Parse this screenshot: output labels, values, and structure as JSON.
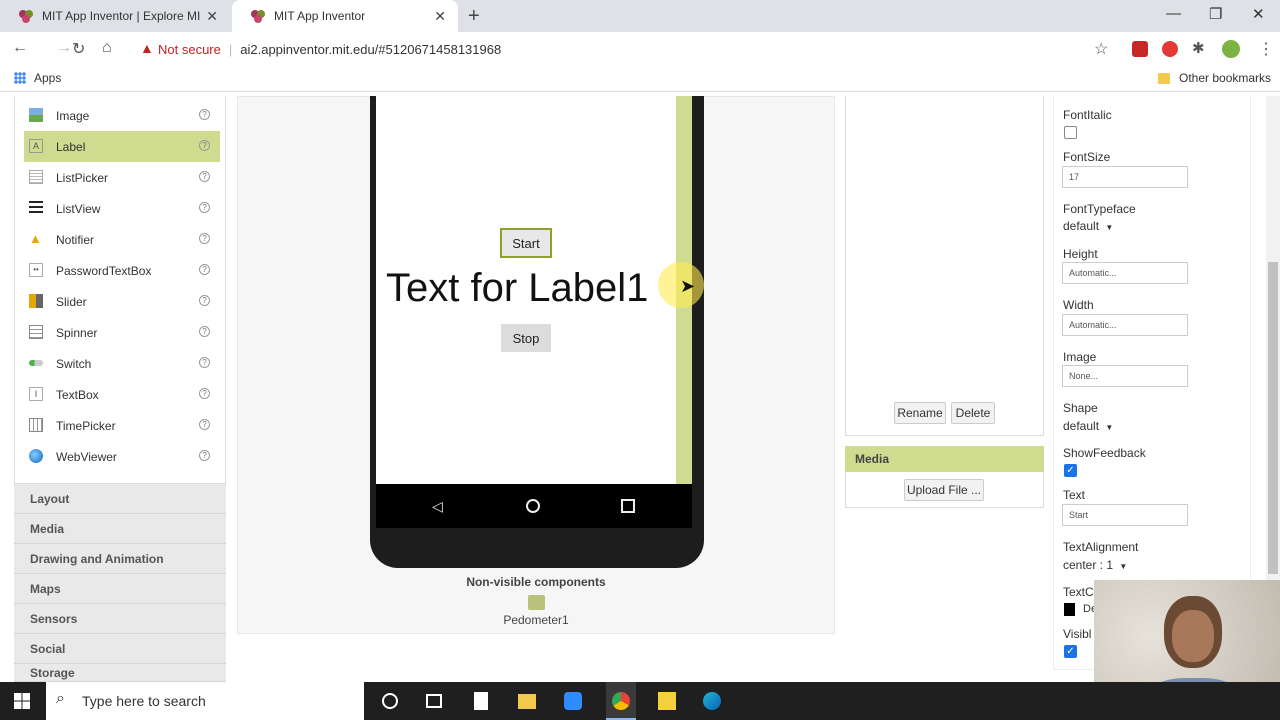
{
  "browser": {
    "tabs": [
      {
        "title": "MIT App Inventor | Explore MIT A",
        "active": false
      },
      {
        "title": "MIT App Inventor",
        "active": true
      }
    ],
    "security_label": "Not secure",
    "url": "ai2.appinventor.mit.edu/#5120671458131968",
    "bookmarks": {
      "apps_label": "Apps",
      "other_label": "Other bookmarks"
    }
  },
  "palette": {
    "items": [
      {
        "label": "Image",
        "icon": "image-icon"
      },
      {
        "label": "Label",
        "icon": "label-icon",
        "selected": true
      },
      {
        "label": "ListPicker",
        "icon": "listpicker-icon"
      },
      {
        "label": "ListView",
        "icon": "listview-icon"
      },
      {
        "label": "Notifier",
        "icon": "notifier-icon"
      },
      {
        "label": "PasswordTextBox",
        "icon": "password-icon"
      },
      {
        "label": "Slider",
        "icon": "slider-icon"
      },
      {
        "label": "Spinner",
        "icon": "spinner-icon"
      },
      {
        "label": "Switch",
        "icon": "switch-icon"
      },
      {
        "label": "TextBox",
        "icon": "textbox-icon"
      },
      {
        "label": "TimePicker",
        "icon": "timepicker-icon"
      },
      {
        "label": "WebViewer",
        "icon": "webviewer-icon"
      }
    ],
    "help_glyph": "?",
    "categories": [
      "Layout",
      "Media",
      "Drawing and Animation",
      "Maps",
      "Sensors",
      "Social",
      "Storage"
    ]
  },
  "viewer": {
    "start_button": "Start",
    "label_text": "Text for Label1",
    "stop_button": "Stop",
    "nonvisible_title": "Non-visible components",
    "nonvisible_item": "Pedometer1"
  },
  "components": {
    "rename_button": "Rename",
    "delete_button": "Delete",
    "media_title": "Media",
    "upload_button": "Upload File ..."
  },
  "properties": {
    "fontitalic_label": "FontItalic",
    "fontsize_label": "FontSize",
    "fontsize_value": "17",
    "fonttypeface_label": "FontTypeface",
    "fonttypeface_value": "default",
    "height_label": "Height",
    "height_value": "Automatic...",
    "width_label": "Width",
    "width_value": "Automatic...",
    "image_label": "Image",
    "image_value": "None...",
    "shape_label": "Shape",
    "shape_value": "default",
    "showfeedback_label": "ShowFeedback",
    "text_label": "Text",
    "text_value": "Start",
    "textalignment_label": "TextAlignment",
    "textalignment_value": "center : 1",
    "textcolor_label": "TextC",
    "textcolor_value": "De",
    "visible_label": "Visibl"
  },
  "taskbar": {
    "search_placeholder": "Type here to search"
  },
  "colors": {
    "accent_green": "#cfdb8f",
    "chrome_bg": "#dee1e6",
    "not_secure_red": "#c5221f",
    "checkbox_blue": "#1a73e8"
  }
}
